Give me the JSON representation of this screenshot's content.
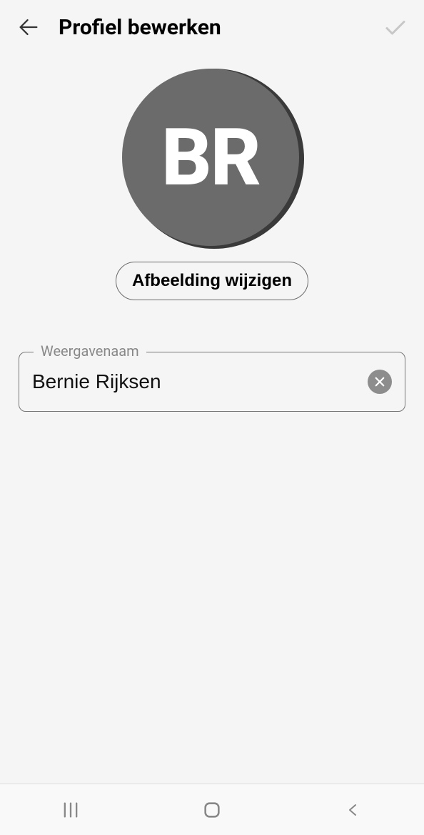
{
  "header": {
    "title": "Profiel bewerken"
  },
  "avatar": {
    "initials": "BR",
    "change_label": "Afbeelding wijzigen"
  },
  "name_field": {
    "label": "Weergavenaam",
    "value": "Bernie Rijksen"
  }
}
